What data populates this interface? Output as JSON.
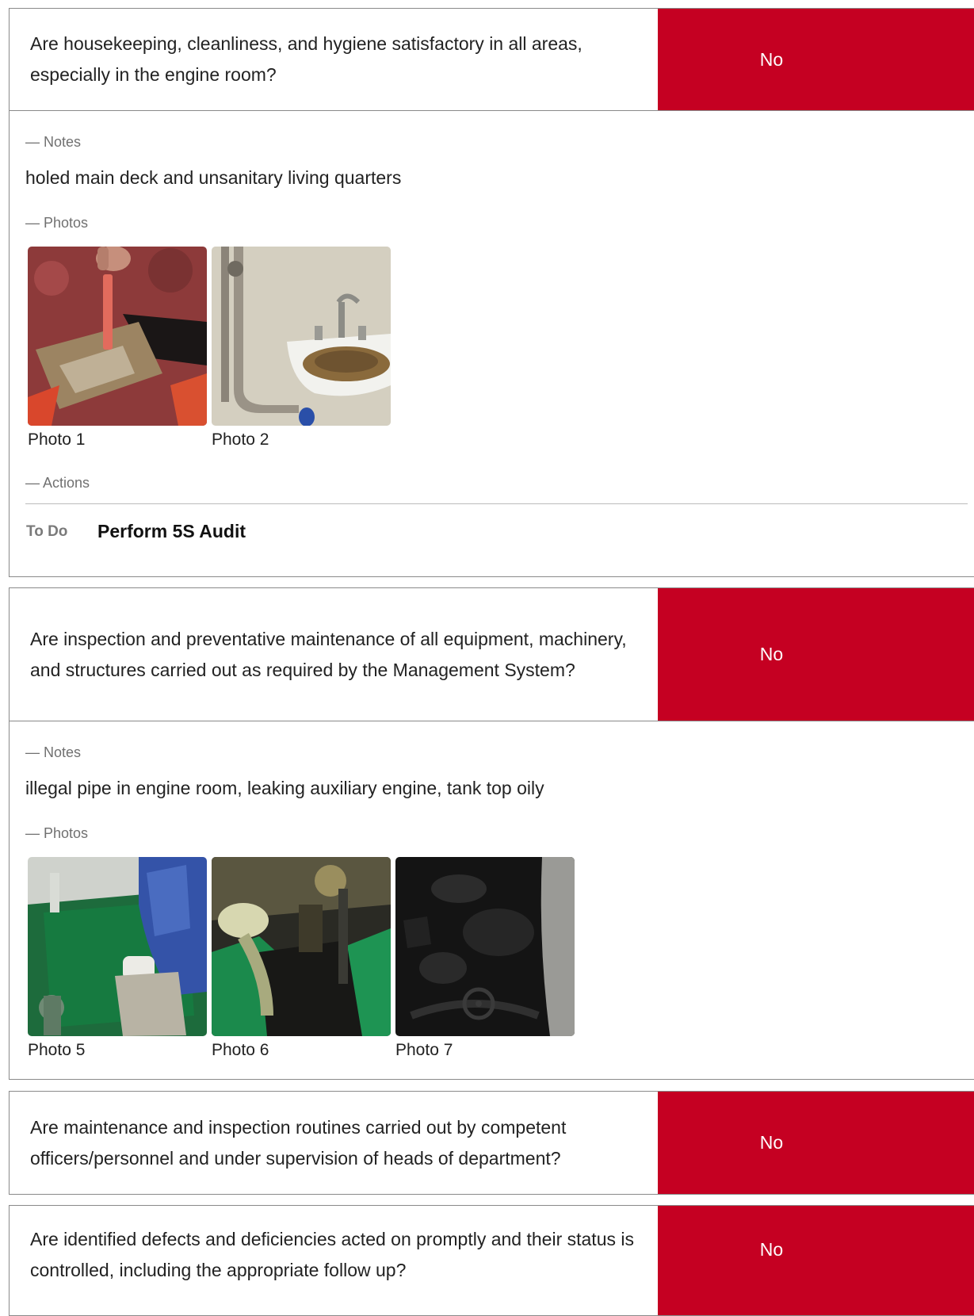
{
  "questions": [
    {
      "text": "Are housekeeping, cleanliness, and hygiene satisfactory in all areas, especially in the engine room?",
      "answer": "No",
      "notes_label": "— Notes",
      "notes": "holed main deck and unsanitary living quarters",
      "photos_label": "— Photos",
      "photos": [
        {
          "caption": "Photo 1"
        },
        {
          "caption": "Photo 2"
        }
      ],
      "actions_label": "— Actions",
      "actions": [
        {
          "status": "To Do",
          "title": "Perform 5S Audit"
        }
      ]
    },
    {
      "text": "Are inspection and preventative maintenance of all equipment, machinery, and structures carried out as required by the Management System?",
      "answer": "No",
      "notes_label": "— Notes",
      "notes": "illegal pipe in engine room, leaking auxiliary engine, tank top oily",
      "photos_label": "— Photos",
      "photos": [
        {
          "caption": "Photo 5"
        },
        {
          "caption": "Photo 6"
        },
        {
          "caption": "Photo 7"
        }
      ]
    },
    {
      "text": "Are maintenance and inspection routines carried out by competent officers/personnel and under supervision of heads of department?",
      "answer": "No"
    },
    {
      "text": "Are identified defects and deficiencies acted on promptly and their status is controlled, including the appropriate follow up?",
      "answer": "No"
    }
  ],
  "colors": {
    "answer_no_bg": "#c50022",
    "answer_text": "#ffffff",
    "label_gray": "#707070",
    "border": "#8a8a8a"
  }
}
